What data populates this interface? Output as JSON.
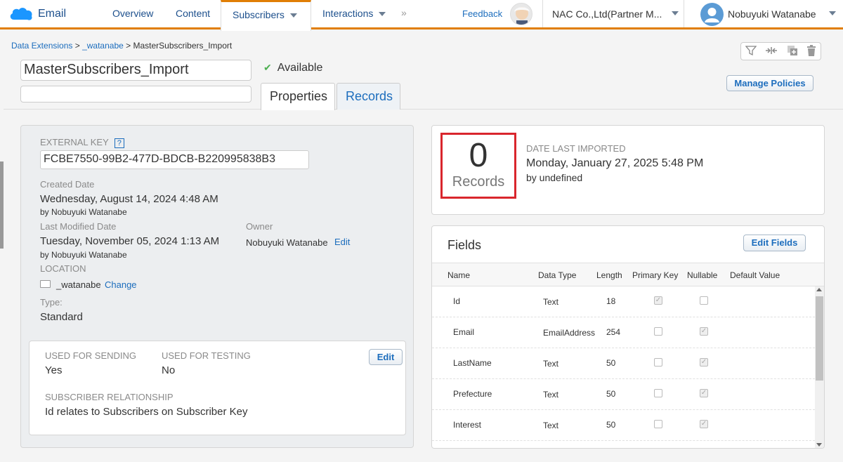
{
  "nav": {
    "brand": "Email",
    "items": [
      "Overview",
      "Content",
      "Subscribers",
      "Interactions"
    ],
    "feedback": "Feedback",
    "org": "NAC Co.,Ltd(Partner M...",
    "user": "Nobuyuki Watanabe"
  },
  "header": {
    "breadcrumb": [
      "Data Extensions",
      "_watanabe",
      "MasterSubscribers_Import"
    ],
    "title": "MasterSubscribers_Import",
    "status": "Available",
    "tabs": [
      "Properties",
      "Records"
    ],
    "manage_policies": "Manage Policies"
  },
  "properties": {
    "external_key_label": "EXTERNAL KEY",
    "help": "?",
    "external_key": "FCBE7550-99B2-477D-BDCB-B220995838B3",
    "created_label": "Created Date",
    "created_value": "Wednesday, August 14, 2024 4:48 AM",
    "created_by": "by Nobuyuki Watanabe",
    "modified_label": "Last Modified Date",
    "modified_value": "Tuesday, November 05, 2024 1:13 AM",
    "modified_by": "by Nobuyuki Watanabe",
    "owner_label": "Owner",
    "owner_value": "Nobuyuki Watanabe",
    "owner_edit": "Edit",
    "location_label": "LOCATION",
    "location_value": "_watanabe",
    "location_change": "Change",
    "type_label": "Type:",
    "type_value": "Standard",
    "sending_label": "USED FOR SENDING",
    "sending_value": "Yes",
    "testing_label": "USED FOR TESTING",
    "testing_value": "No",
    "edit_label": "Edit",
    "relationship_label": "SUBSCRIBER RELATIONSHIP",
    "relationship_value": "Id relates to Subscribers on Subscriber Key"
  },
  "records": {
    "count": "0",
    "label": "Records",
    "date_label": "DATE LAST IMPORTED",
    "date_value": "Monday, January 27, 2025 5:48 PM",
    "date_by": "by undefined"
  },
  "fields": {
    "title": "Fields",
    "edit_fields": "Edit Fields",
    "headers": [
      "Name",
      "Data Type",
      "Length",
      "Primary Key",
      "Nullable",
      "Default Value"
    ],
    "rows": [
      {
        "name": "Id",
        "type": "Text",
        "length": "18",
        "primary_key": true,
        "nullable": false
      },
      {
        "name": "Email",
        "type": "EmailAddress",
        "length": "254",
        "primary_key": false,
        "nullable": true
      },
      {
        "name": "LastName",
        "type": "Text",
        "length": "50",
        "primary_key": false,
        "nullable": true
      },
      {
        "name": "Prefecture",
        "type": "Text",
        "length": "50",
        "primary_key": false,
        "nullable": true
      },
      {
        "name": "Interest",
        "type": "Text",
        "length": "50",
        "primary_key": false,
        "nullable": true
      }
    ]
  },
  "colors": {
    "accent": "#e07e05",
    "link": "#1c6dbd",
    "highlight": "#d9262d"
  }
}
